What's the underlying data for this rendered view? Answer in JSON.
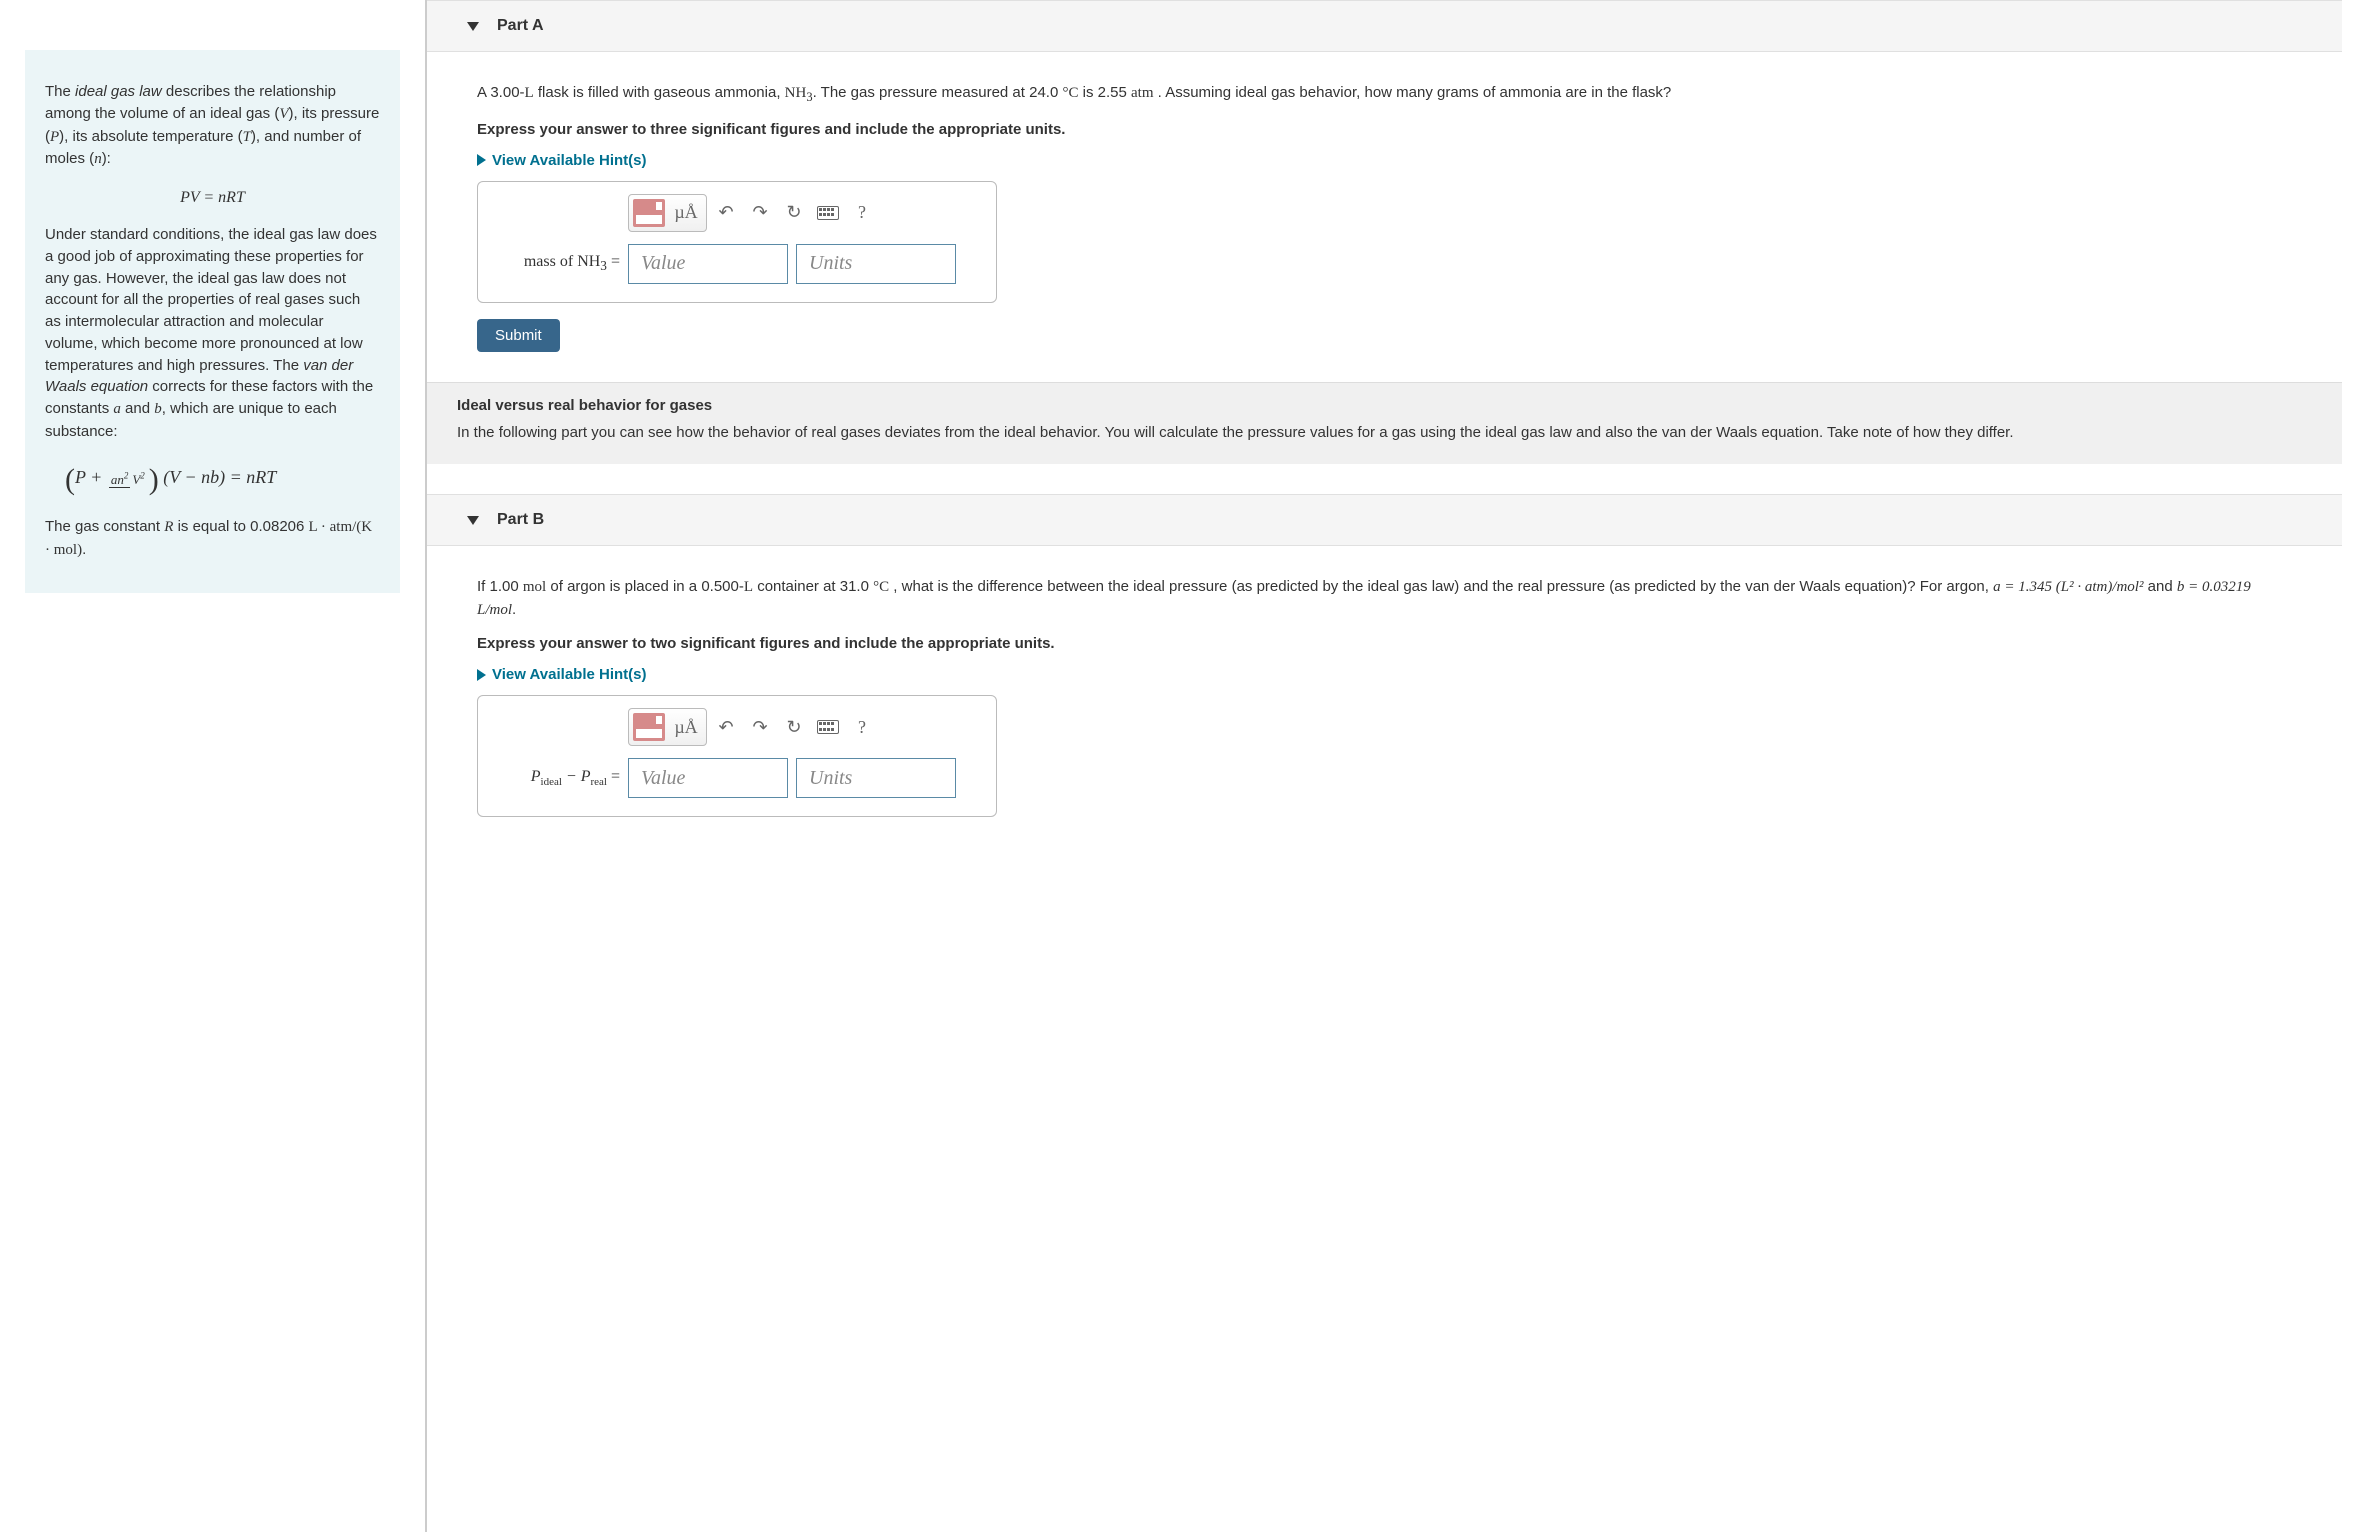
{
  "sidebar": {
    "para1_a": "The ",
    "para1_b": "ideal gas law",
    "para1_c": " describes the relationship among the volume of an ideal gas (",
    "para1_d": "), its pressure (",
    "para1_e": "), its absolute temperature (",
    "para1_f": "), and number of moles (",
    "para1_g": "):",
    "var_V": "V",
    "var_P": "P",
    "var_T": "T",
    "var_n": "n",
    "eq1": "PV = nRT",
    "para2_a": "Under standard conditions, the ideal gas law does a good job of approximating these properties for any gas. However, the ideal gas law does not account for all the properties of real gases such as intermolecular attraction and molecular volume, which become more pronounced at low temperatures and high pressures. The ",
    "para2_b": "van der Waals equation",
    "para2_c": " corrects for these factors with the constants ",
    "var_a": "a",
    "para2_d": " and ",
    "var_b": "b",
    "para2_e": ", which are unique to each substance:",
    "eq2_html": "ignored",
    "para3_a": "The gas constant ",
    "var_R": "R",
    "para3_b": " is equal to 0.08206 ",
    "units_R": "L · atm/(K · mol)",
    "para3_c": "."
  },
  "partA": {
    "label": "Part A",
    "question_a": "A 3.00-",
    "q_L": "L",
    "question_b": " flask is filled with gaseous ammonia, ",
    "q_NH3": "NH",
    "q_NH3_sub": "3",
    "question_c": ". The gas pressure measured at 24.0 ",
    "q_degC": "°C",
    "question_d": " is 2.55 ",
    "q_atm": "atm",
    "question_e": " . Assuming ideal gas behavior, how many grams of ammonia are in the flask?",
    "instruction": "Express your answer to three significant figures and include the appropriate units.",
    "hints": "View Available Hint(s)",
    "answer_label_a": "mass of NH",
    "answer_label_b": "3",
    "answer_label_c": " =",
    "value_ph": "Value",
    "units_ph": "Units",
    "submit": "Submit",
    "mu_a": "µÅ",
    "help": "?"
  },
  "sectionNote": {
    "title": "Ideal versus real behavior for gases",
    "body": "In the following part you can see how the behavior of real gases deviates from the ideal behavior. You will calculate the pressure values for a gas using the ideal gas law and also the van der Waals equation. Take note of how they differ."
  },
  "partB": {
    "label": "Part B",
    "question_a": "If 1.00 ",
    "q_mol": "mol",
    "question_b": " of argon is placed in a 0.500-",
    "q_L": "L",
    "question_c": " container at 31.0 ",
    "q_degC": "°C",
    "question_d": " , what is the difference between the ideal pressure (as predicted by the ideal gas law) and the real pressure (as predicted by the van der Waals equation)? For argon, ",
    "q_a_eq": "a = 1.345 (L² · atm)/mol²",
    "question_e": " and ",
    "q_b_eq": "b = 0.03219 L/mol",
    "question_f": ".",
    "instruction": "Express your answer to two significant figures and include the appropriate units.",
    "hints": "View Available Hint(s)",
    "answer_label_a": "P",
    "answer_label_ideal": "ideal",
    "answer_label_minus": " − ",
    "answer_label_b": "P",
    "answer_label_real": "real",
    "answer_label_eq": " =",
    "value_ph": "Value",
    "units_ph": "Units",
    "mu_a": "µÅ",
    "help": "?"
  }
}
